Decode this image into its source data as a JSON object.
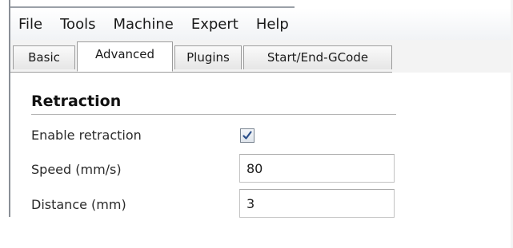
{
  "menu": {
    "items": [
      {
        "label": "File"
      },
      {
        "label": "Tools"
      },
      {
        "label": "Machine"
      },
      {
        "label": "Expert"
      },
      {
        "label": "Help"
      }
    ]
  },
  "tabs": {
    "items": [
      {
        "label": "Basic"
      },
      {
        "label": "Advanced",
        "active": true
      },
      {
        "label": "Plugins"
      },
      {
        "label": "Start/End-GCode"
      }
    ]
  },
  "retraction": {
    "title": "Retraction",
    "enable_label": "Enable retraction",
    "enable_checked": true,
    "speed_label": "Speed (mm/s)",
    "speed_value": "80",
    "distance_label": "Distance (mm)",
    "distance_value": "3"
  },
  "colors": {
    "check_mark": "#2b4f8a"
  }
}
